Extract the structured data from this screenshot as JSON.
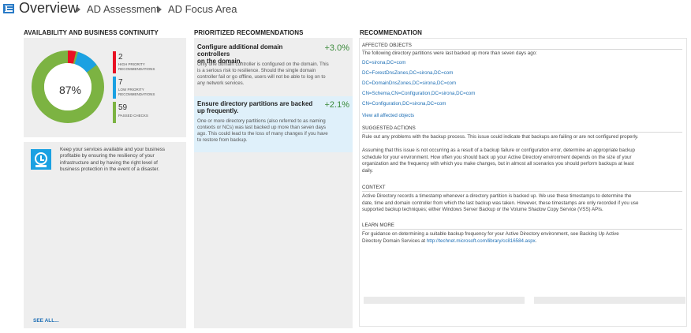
{
  "header": {
    "title": "Overview",
    "crumbs": [
      "AD Assessment",
      "AD Focus Area"
    ]
  },
  "availability": {
    "title": "AVAILABILITY AND BUSINESS CONTINUITY",
    "percent_label": "87%",
    "high": {
      "count": "2",
      "label_line1": "HIGH PRIORITY",
      "label_line2": "RECOMMENDATIONS",
      "color": "#e81123"
    },
    "low": {
      "count": "7",
      "label_line1": "LOW PRIORITY",
      "label_line2": "RECOMMENDATIONS",
      "color": "#1ba1e2"
    },
    "passed": {
      "count": "59",
      "label_line1": "PASSED CHECKS",
      "color": "#7cb342"
    },
    "info_lines": [
      "Keep your services available and your business",
      "profitable by ensuring the resiliency of your",
      "infrastructure and by having the right level of",
      "business protection in the event of a disaster."
    ],
    "info_icon": "clock-icon",
    "see_all": "SEE ALL..."
  },
  "recommendations": {
    "title": "PRIORITIZED RECOMMENDATIONS",
    "items": [
      {
        "title_lines": [
          "Configure additional domain controllers",
          "on the domain."
        ],
        "delta": "+3.0%",
        "body_lines": [
          "Only one domain controller is configured on the domain. This",
          "is a serious risk to resilience. Should the single domain",
          "controller fail or go offline, users will not be able to log on to",
          "any network services."
        ]
      },
      {
        "title_lines": [
          "Ensure directory partitions are backed",
          "up frequently."
        ],
        "delta": "+2.1%",
        "body_lines": [
          "One or more directory partitions (also referred to as naming",
          "contexts or NCs) was last backed up more than seven days",
          "ago. This could lead to the loss of many changes if you have",
          "to restore from backup."
        ]
      }
    ]
  },
  "detail": {
    "title": "RECOMMENDATION",
    "affected_head": "AFFECTED OBJECTS",
    "affected_intro": "The following directory partitions were last backed up more than seven days ago:",
    "objects": [
      "DC=sirona,DC=com",
      "DC=ForestDnsZones,DC=sirona,DC=com",
      "DC=DomainDnsZones,DC=sirona,DC=com",
      "CN=Schema,CN=Configuration,DC=sirona,DC=com",
      "CN=Configuration,DC=sirona,DC=com"
    ],
    "view_all": "View all affected objects",
    "suggested_head": "SUGGESTED ACTIONS",
    "suggested_p1": "Rule out any problems with the backup process. This issue could indicate that backups are failing or are not configured properly.",
    "suggested_p2_lines": [
      "Assuming that this issue is not occurring as a result of a backup failure or configuration error, determine an appropriate backup",
      "schedule for your environment. How often you should back up your Active Directory environment depends on the size of your",
      "organization and the frequency with which you make changes, but in almost all scenarios you should perform backups at least",
      "daily."
    ],
    "context_head": "CONTEXT",
    "context_lines": [
      "Active Directory records a timestamp whenever a directory partition is backed up. We use these timestamps to determine the",
      "date, time and domain controller from which the last backup was taken. However, these timestamps are only recorded if you use",
      "supported backup techniques; either Windows Server Backup or the Volume Shadow Copy Service (VSS) APIs."
    ],
    "learn_head": "LEARN MORE",
    "learn_line1": "For guidance on determining a suitable backup frequency for your Active Directory environment, see Backing Up Active",
    "learn_line2_prefix": "Directory Domain Services at ",
    "learn_link": "http://technet.microsoft.com/library/cc816584.aspx",
    "learn_line2_suffix": "."
  }
}
